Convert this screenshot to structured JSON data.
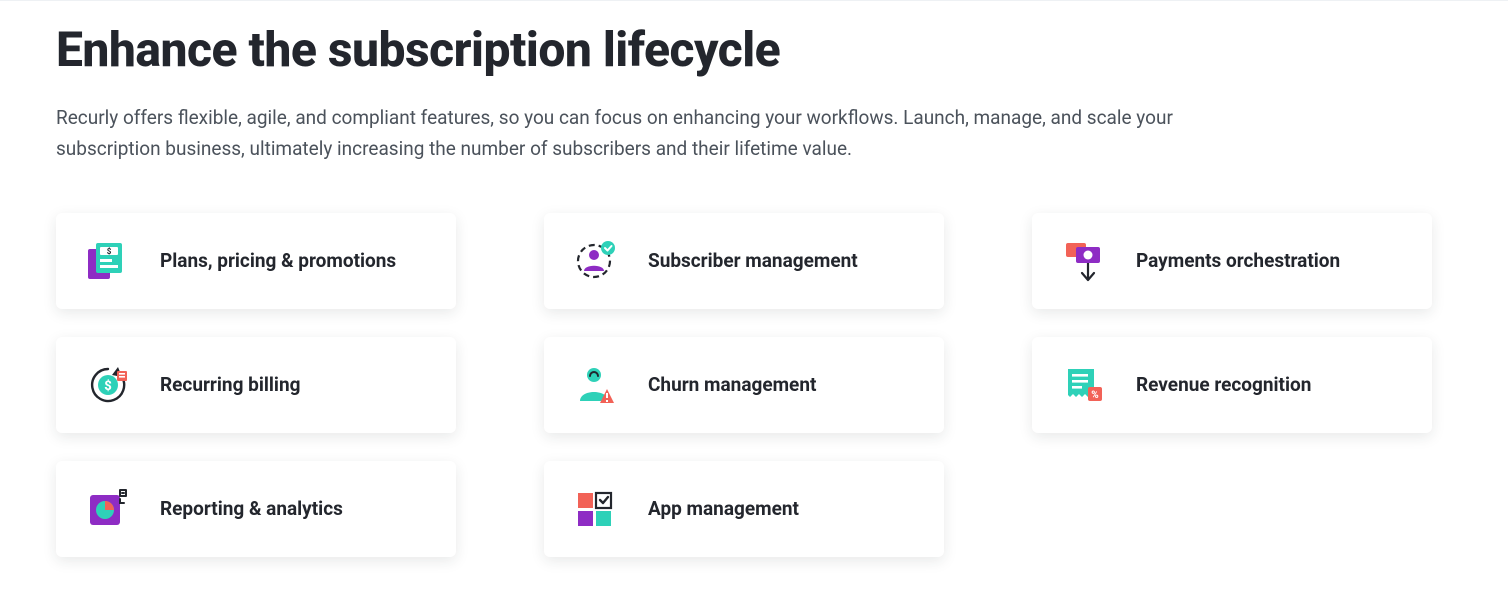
{
  "section": {
    "title": "Enhance the subscription lifecycle",
    "description": "Recurly offers flexible, agile, and compliant features, so you can focus on enhancing your workflows. Launch, manage, and scale your subscription business, ultimately increasing the number of subscribers and their lifetime value."
  },
  "columns": [
    {
      "cards": [
        {
          "icon": "plans-pricing-icon",
          "label": "Plans, pricing & promotions"
        },
        {
          "icon": "recurring-billing-icon",
          "label": "Recurring billing"
        },
        {
          "icon": "reporting-analytics-icon",
          "label": "Reporting & analytics"
        }
      ]
    },
    {
      "cards": [
        {
          "icon": "subscriber-management-icon",
          "label": "Subscriber management"
        },
        {
          "icon": "churn-management-icon",
          "label": "Churn management"
        },
        {
          "icon": "app-management-icon",
          "label": "App management"
        }
      ]
    },
    {
      "cards": [
        {
          "icon": "payments-orchestration-icon",
          "label": "Payments orchestration"
        },
        {
          "icon": "revenue-recognition-icon",
          "label": "Revenue recognition"
        }
      ]
    }
  ],
  "colors": {
    "purple": "#8e2cc4",
    "teal": "#2ed1b8",
    "coral": "#f26257",
    "dark": "#23262d",
    "text": "#4b525b"
  }
}
